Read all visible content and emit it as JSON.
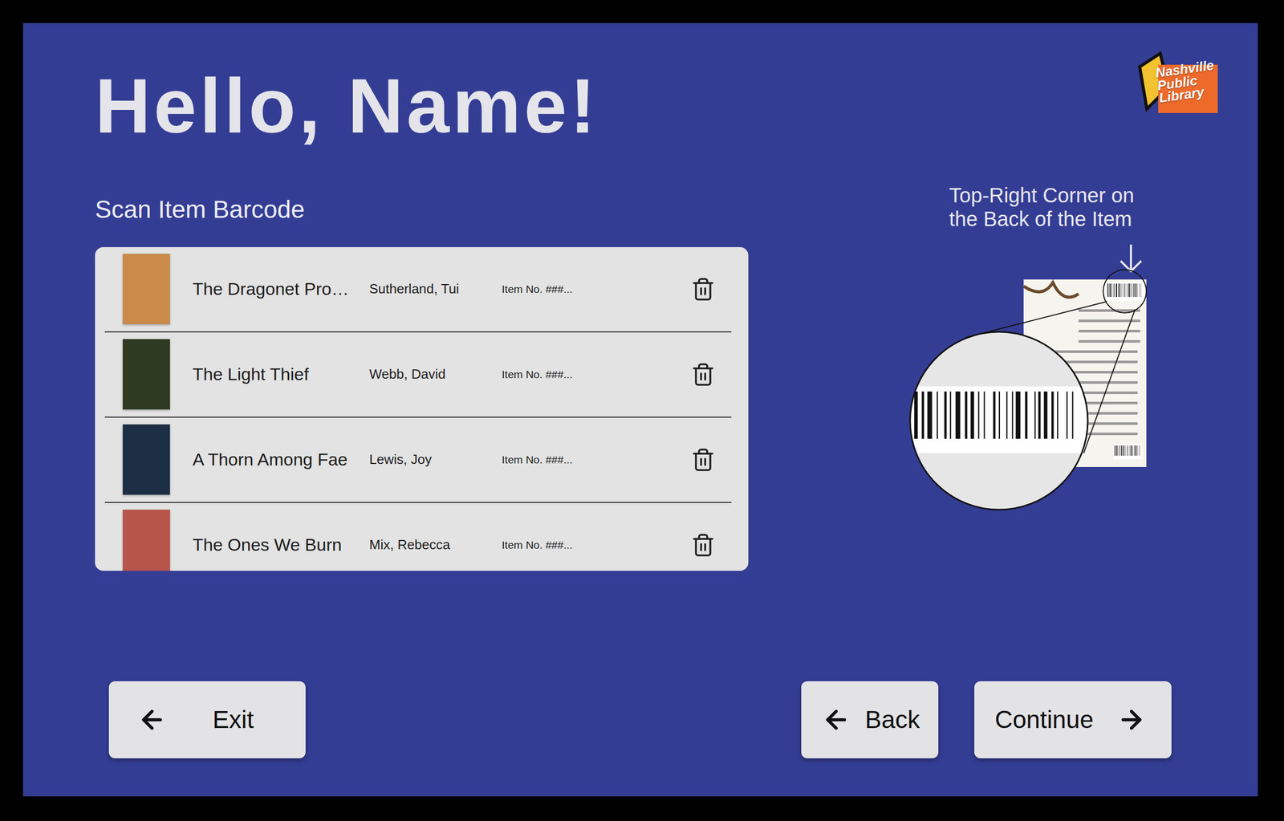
{
  "greeting": "Hello, Name!",
  "logo": {
    "lines": [
      "Nashville",
      "Public",
      "Library"
    ]
  },
  "prompt": "Scan Item Barcode",
  "items": [
    {
      "title": "The Dragonet Pro…",
      "author": "Sutherland, Tui",
      "item_no": "Item No. ###...",
      "color": "#c98a4a"
    },
    {
      "title": "The Light Thief",
      "author": "Webb, David",
      "item_no": "Item No. ###...",
      "color": "#2f3a22"
    },
    {
      "title": "A Thorn Among Fae",
      "author": "Lewis, Joy",
      "item_no": "Item No. ###...",
      "color": "#1d2f45"
    },
    {
      "title": "The Ones We Burn",
      "author": "Mix, Rebecca",
      "item_no": "Item No. ###...",
      "color": "#b8554a"
    }
  ],
  "hint": {
    "lines": [
      "Top-Right Corner on",
      "the Back of the Item"
    ]
  },
  "exit_button": {
    "label": "Exit",
    "arrow": "left"
  },
  "nav_buttons": [
    {
      "label": "Back",
      "arrow": "left"
    },
    {
      "label": "Continue",
      "arrow": "right"
    }
  ]
}
